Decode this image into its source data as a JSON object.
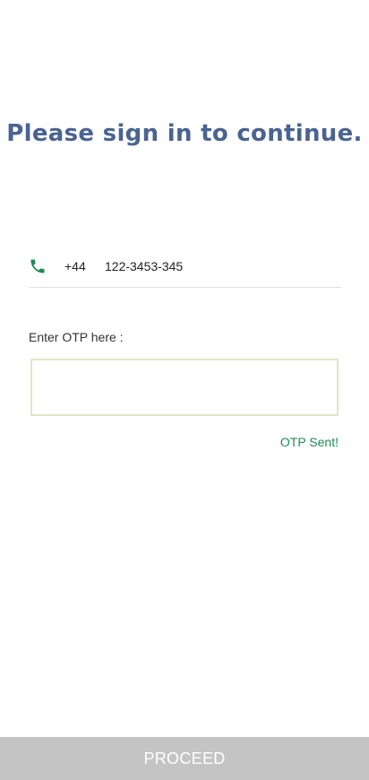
{
  "header": {
    "title": "Please sign in to continue."
  },
  "phone": {
    "icon": "phone-icon",
    "icon_color": "#1e8c55",
    "country_code": "+44",
    "number": "122-3453-345"
  },
  "otp": {
    "label": "Enter OTP here :",
    "value": "",
    "status": "OTP Sent!",
    "status_color": "#1e8c55"
  },
  "actions": {
    "proceed_label": "PROCEED"
  },
  "colors": {
    "title": "#4a6390",
    "proceed_bg": "#c4c4c4",
    "input_border": "#dfe6c8"
  }
}
